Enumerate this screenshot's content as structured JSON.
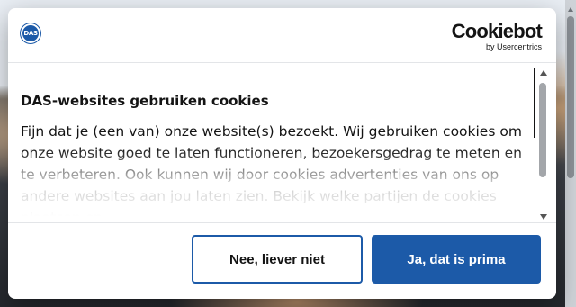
{
  "brand": {
    "das_logo_text": "DAS",
    "cookiebot_name": "Cookiebot",
    "cookiebot_sub": "by Usercentrics"
  },
  "consent": {
    "title": "DAS-websites gebruiken cookies",
    "body": "Fijn dat je (een van) onze website(s) bezoekt. Wij gebruiken cookies om onze website goed te laten functioneren, bezoekersgedrag te meten en te verbeteren. Ook kunnen wij door cookies advertenties van ons op andere websites aan jou laten zien. Bekijk welke partijen de cookies plaatsen en"
  },
  "buttons": {
    "decline_label": "Nee, liever niet",
    "accept_label": "Ja, dat is prima"
  },
  "colors": {
    "accent": "#1c5aa8",
    "text": "#141414"
  }
}
